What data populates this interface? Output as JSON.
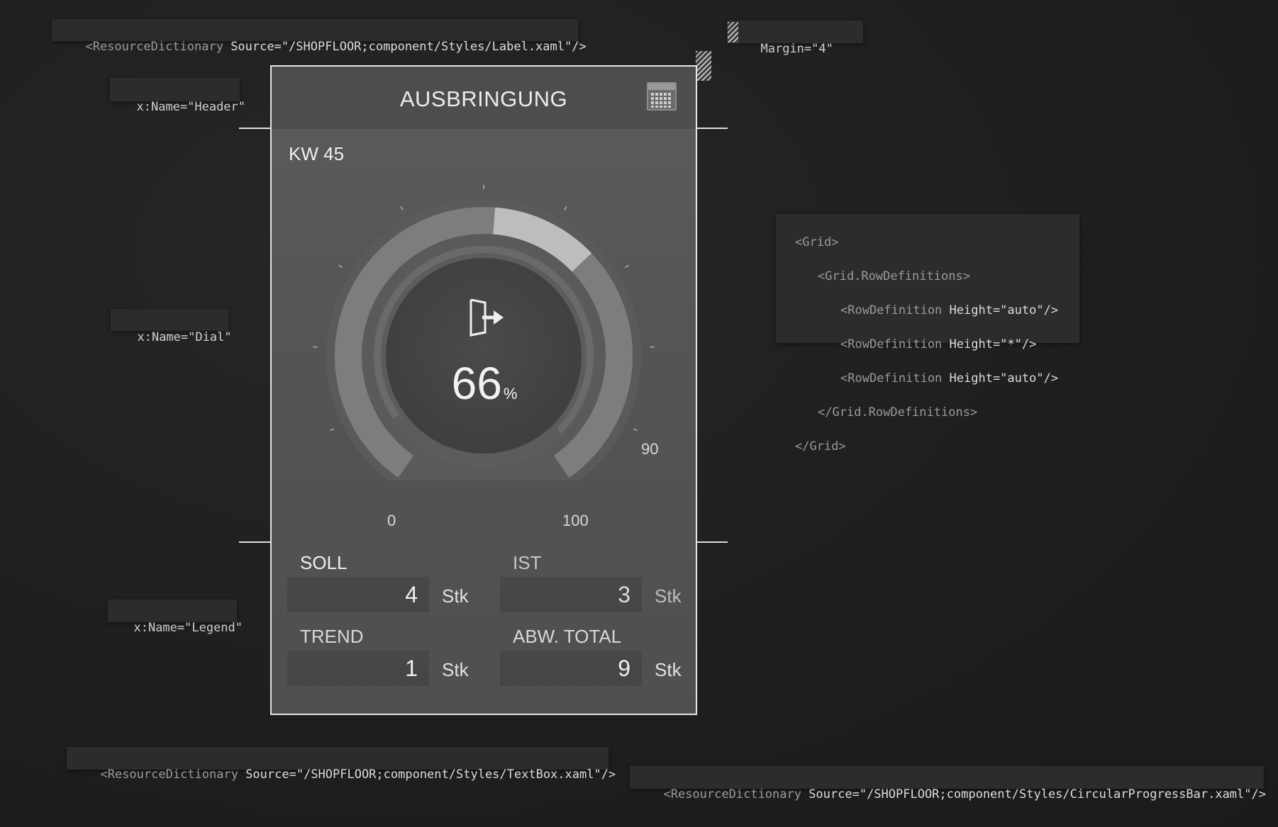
{
  "notes": {
    "label_dict": {
      "tag": "<ResourceDictionary",
      "attr": " Source=\"/SHOPFLOOR;component/Styles/Label.xaml\"/>"
    },
    "margin": "Margin=\"4\"",
    "header_name": "x:Name=\"Header\"",
    "dial_name": "x:Name=\"Dial\"",
    "legend_name": "x:Name=\"Legend\"",
    "grid_code": {
      "l1": "<Grid>",
      "l2": "<Grid.RowDefinitions>",
      "l3_tag": "<RowDefinition",
      "l3_attr": " Height=\"auto\"/>",
      "l4_tag": "<RowDefinition",
      "l4_attr": " Height=\"*\"/>",
      "l5_tag": "<RowDefinition",
      "l5_attr": " Height=\"auto\"/>",
      "l6": "</Grid.RowDefinitions>",
      "l7": "</Grid>"
    },
    "textbox_dict": {
      "tag": "<ResourceDictionary",
      "attr": " Source=\"/SHOPFLOOR;component/Styles/TextBox.xaml\"/>"
    },
    "progress_dict": {
      "tag": "<ResourceDictionary",
      "attr": " Source=\"/SHOPFLOOR;component/Styles/CircularProgressBar.xaml\"/>"
    }
  },
  "card": {
    "title": "AUSBRINGUNG",
    "calendar_icon": "calendar-icon",
    "week": "KW 45",
    "dial": {
      "value": "66",
      "unit": "%",
      "fraction": 0.66,
      "icon": "exit-door-icon",
      "scale_labels": {
        "start": "0",
        "end": "100",
        "marker": "90"
      },
      "marker_fraction": 0.9
    },
    "legend": {
      "soll": {
        "label": "SOLL",
        "value": "4",
        "unit": "Stk"
      },
      "ist": {
        "label": "IST",
        "value": "3",
        "unit": "Stk"
      },
      "trend": {
        "label": "TREND",
        "value": "1",
        "unit": "Stk"
      },
      "abw": {
        "label": "ABW. TOTAL",
        "value": "9",
        "unit": "Stk"
      }
    }
  },
  "colors": {
    "background": "#1f1f1f",
    "card": "#555555",
    "ring_track": "#8a8a8a",
    "ring_progress": "#bfbfbf",
    "border": "#e6e6e6"
  }
}
